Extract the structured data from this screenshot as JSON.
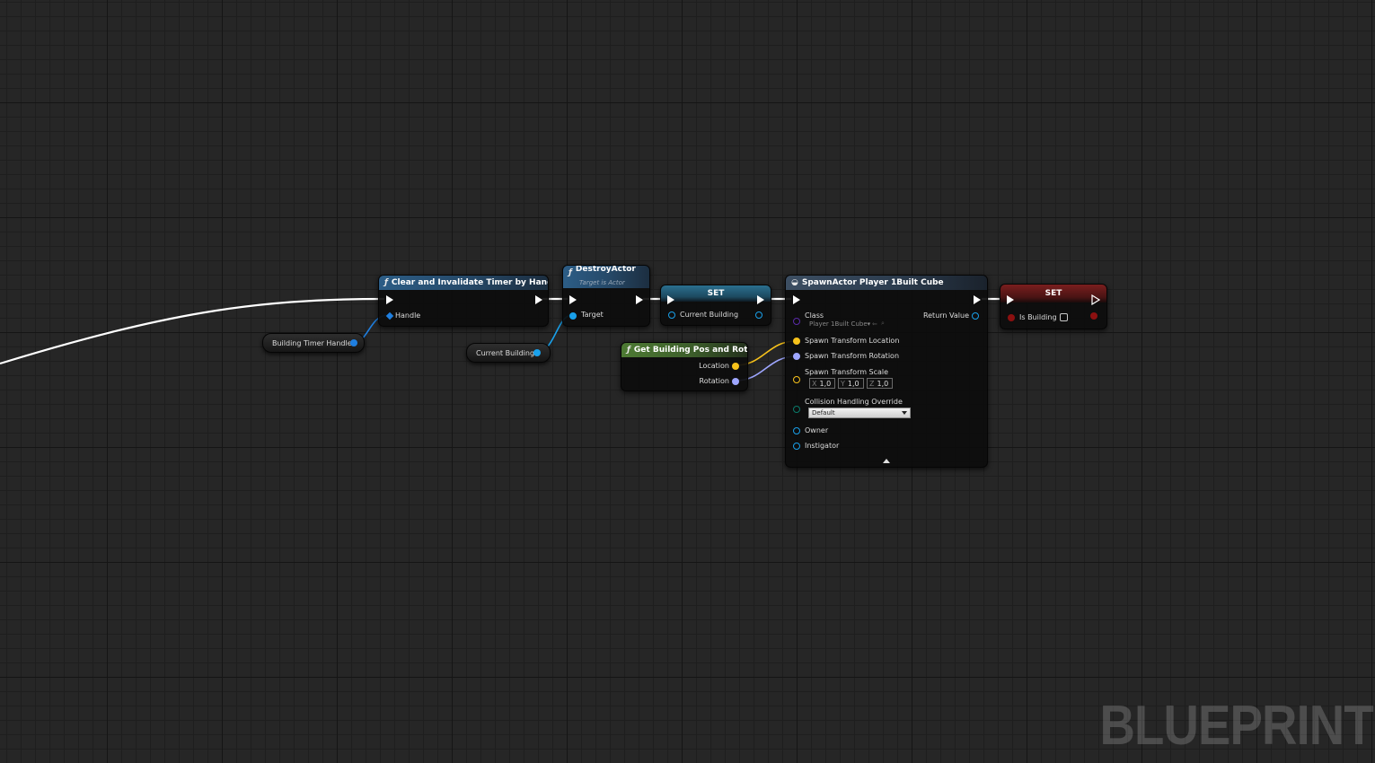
{
  "watermark": "BLUEPRINT",
  "colors": {
    "exec": "#ffffff",
    "object": "#19a0ea",
    "struct_handle": "#1f7fe0",
    "vector": "#f7c21b",
    "rotator": "#9ea6ff",
    "boolean": "#8c1010",
    "class": "#5a2aa8"
  },
  "clear_timer": {
    "icon": "function-icon",
    "title": "Clear and Invalidate Timer by Handle",
    "handle_label": "Handle"
  },
  "building_timer_handle": {
    "label": "Building Timer Handle"
  },
  "destroy_actor": {
    "icon": "function-icon",
    "title": "DestroyActor",
    "subtitle": "Target is Actor",
    "target_label": "Target"
  },
  "current_building_getter": {
    "label": "Current Building"
  },
  "set_current": {
    "title": "SET",
    "var_label": "Current Building"
  },
  "get_pos_rot": {
    "icon": "function-icon",
    "title": "Get Building Pos and Rot",
    "location_label": "Location",
    "rotation_label": "Rotation"
  },
  "spawn_actor": {
    "icon": "spawn-icon",
    "title": "SpawnActor Player 1Built Cube",
    "class_label": "Class",
    "class_value": "Player 1Built Cube",
    "return_label": "Return Value",
    "spawn_location_label": "Spawn Transform Location",
    "spawn_rotation_label": "Spawn Transform Rotation",
    "spawn_scale_label": "Spawn Transform Scale",
    "scale": {
      "x_axis": "X",
      "x": "1,0",
      "y_axis": "Y",
      "y": "1,0",
      "z_axis": "Z",
      "z": "1,0"
    },
    "collision_label": "Collision Handling Override",
    "collision_value": "Default",
    "owner_label": "Owner",
    "instigator_label": "Instigator"
  },
  "set_building": {
    "title": "SET",
    "var_label": "Is Building",
    "checked": false
  }
}
